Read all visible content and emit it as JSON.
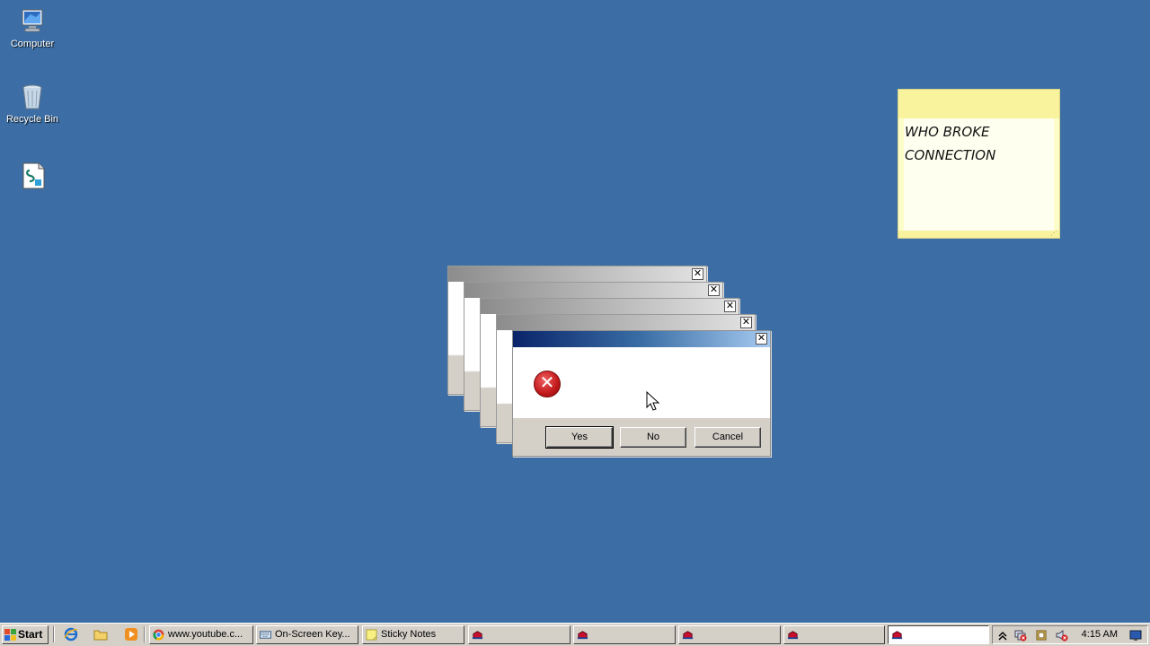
{
  "desktop": {
    "icons": [
      {
        "label": "Computer",
        "icon": "computer-icon"
      },
      {
        "label": "Recycle Bin",
        "icon": "recycle-bin-icon"
      },
      {
        "label": "",
        "icon": "script-file-icon"
      }
    ]
  },
  "sticky_note": {
    "text": "WHO BROKE\nCONNECTION"
  },
  "dialog": {
    "icon": "error-icon",
    "close_symbol": "✕",
    "buttons": {
      "yes": "Yes",
      "no": "No",
      "cancel": "Cancel"
    }
  },
  "taskbar": {
    "start_label": "Start",
    "quick_launch": [
      "ie-icon",
      "folder-icon",
      "media-player-icon"
    ],
    "tasks": [
      {
        "label": "www.youtube.c...",
        "icon": "chrome-icon"
      },
      {
        "label": "On-Screen Key...",
        "icon": "keyboard-icon"
      },
      {
        "label": "Sticky Notes",
        "icon": "sticky-notes-icon"
      },
      {
        "label": "",
        "icon": "app-icon"
      },
      {
        "label": "",
        "icon": "app-icon"
      },
      {
        "label": "",
        "icon": "app-icon"
      },
      {
        "label": "",
        "icon": "app-icon"
      },
      {
        "label": "",
        "icon": "app-icon"
      }
    ],
    "tray": {
      "time": "4:15 AM",
      "icons": [
        "show-hidden-icon",
        "network-error-icon",
        "action-center-icon",
        "volume-muted-icon",
        "show-desktop-icon"
      ]
    }
  },
  "colors": {
    "desktop_bg": "#3c6ea5",
    "title_active": "#0a246a",
    "face": "#d4d0c8"
  }
}
